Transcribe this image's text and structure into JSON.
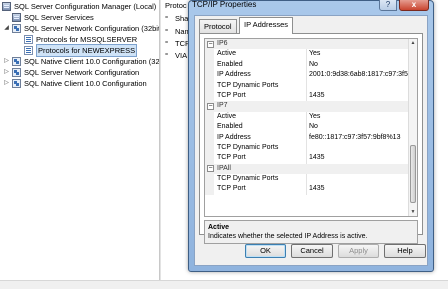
{
  "tree": {
    "items": [
      {
        "label": "SQL Server Configuration Manager (Local)",
        "icon": "server-icon",
        "level": 0
      },
      {
        "label": "SQL Server Services",
        "icon": "server-icon",
        "level": 1
      },
      {
        "label": "SQL Server Network Configuration (32bit",
        "icon": "network-icon",
        "level": 1
      },
      {
        "label": "Protocols for MSSQLSERVER",
        "icon": "protocol-icon",
        "level": 2
      },
      {
        "label": "Protocols for NEWEXPRESS",
        "icon": "protocol-icon",
        "level": 2,
        "selected": true
      },
      {
        "label": "SQL Native Client 10.0 Configuration (32t",
        "icon": "network-icon",
        "level": 1
      },
      {
        "label": "SQL Server Network Configuration",
        "icon": "network-icon",
        "level": 1
      },
      {
        "label": "SQL Native Client 10.0 Configuration",
        "icon": "network-icon",
        "level": 1
      }
    ]
  },
  "right_pane": {
    "header": "Protoc",
    "rows": [
      "Shar",
      "Nam",
      "TCP",
      "VIA"
    ]
  },
  "dialog": {
    "title": "TCP/IP Properties",
    "help_glyph": "?",
    "close_glyph": "x",
    "tabs": [
      {
        "label": "Protocol",
        "active": false
      },
      {
        "label": "IP Addresses",
        "active": true
      }
    ],
    "grid": [
      {
        "type": "category",
        "name": "IP6",
        "toggle": "⊟"
      },
      {
        "type": "prop",
        "name": "Active",
        "value": "Yes"
      },
      {
        "type": "prop",
        "name": "Enabled",
        "value": "No"
      },
      {
        "type": "prop",
        "name": "IP Address",
        "value": "2001:0:9d38:6ab8:1817:c97:3f57"
      },
      {
        "type": "prop",
        "name": "TCP Dynamic Ports",
        "value": ""
      },
      {
        "type": "prop",
        "name": "TCP Port",
        "value": "1435"
      },
      {
        "type": "category",
        "name": "IP7",
        "toggle": "⊟"
      },
      {
        "type": "prop",
        "name": "Active",
        "value": "Yes"
      },
      {
        "type": "prop",
        "name": "Enabled",
        "value": "No"
      },
      {
        "type": "prop",
        "name": "IP Address",
        "value": "fe80::1817:c97:3f57:9bf8%13"
      },
      {
        "type": "prop",
        "name": "TCP Dynamic Ports",
        "value": ""
      },
      {
        "type": "prop",
        "name": "TCP Port",
        "value": "1435"
      },
      {
        "type": "category",
        "name": "IPAll",
        "toggle": "⊟"
      },
      {
        "type": "prop",
        "name": "TCP Dynamic Ports",
        "value": ""
      },
      {
        "type": "prop",
        "name": "TCP Port",
        "value": "1435"
      }
    ],
    "description": {
      "title": "Active",
      "text": "Indicates whether the selected IP Address is active."
    },
    "buttons": {
      "ok": "OK",
      "cancel": "Cancel",
      "apply": "Apply",
      "help": "Help"
    }
  }
}
